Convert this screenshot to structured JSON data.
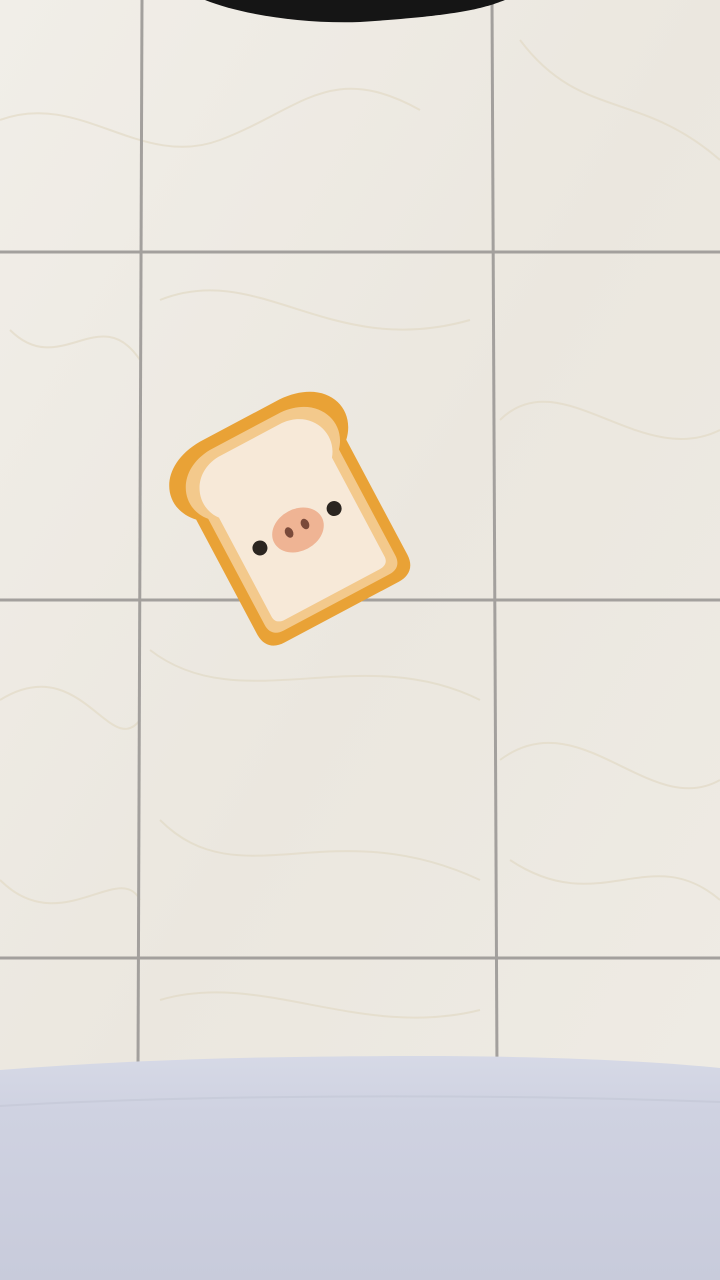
{
  "scene": {
    "title": "",
    "colors": {
      "tile_base": "#eeebe4",
      "grout": "#9c9a98",
      "marble_vein": "#e3dccb",
      "counter_top": "#d3d6e4",
      "counter_front": "#c9cbdb",
      "top_object": "#151515",
      "toast_crust": "#e9a236",
      "toast_inner_crust": "#f3c98c",
      "toast_crumb": "#f7e9d8",
      "toast_nose": "#efb494",
      "toast_eyes": "#2b2520"
    }
  },
  "toast": {
    "icon": "toast-pig-face-icon",
    "rotation_degrees": -28
  }
}
